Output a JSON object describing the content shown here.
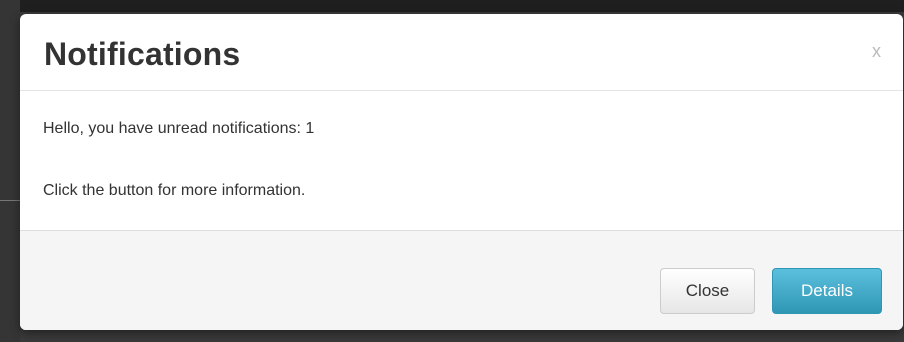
{
  "modal": {
    "title": "Notifications",
    "close_glyph": "x",
    "body": {
      "line1": "Hello, you have unread notifications: 1",
      "line2": "Click the button for more information."
    },
    "footer": {
      "close_label": "Close",
      "details_label": "Details"
    }
  },
  "colors": {
    "details_button": "#49afcd",
    "footer_background": "#f5f5f5",
    "backdrop": "#3a3a3a"
  }
}
